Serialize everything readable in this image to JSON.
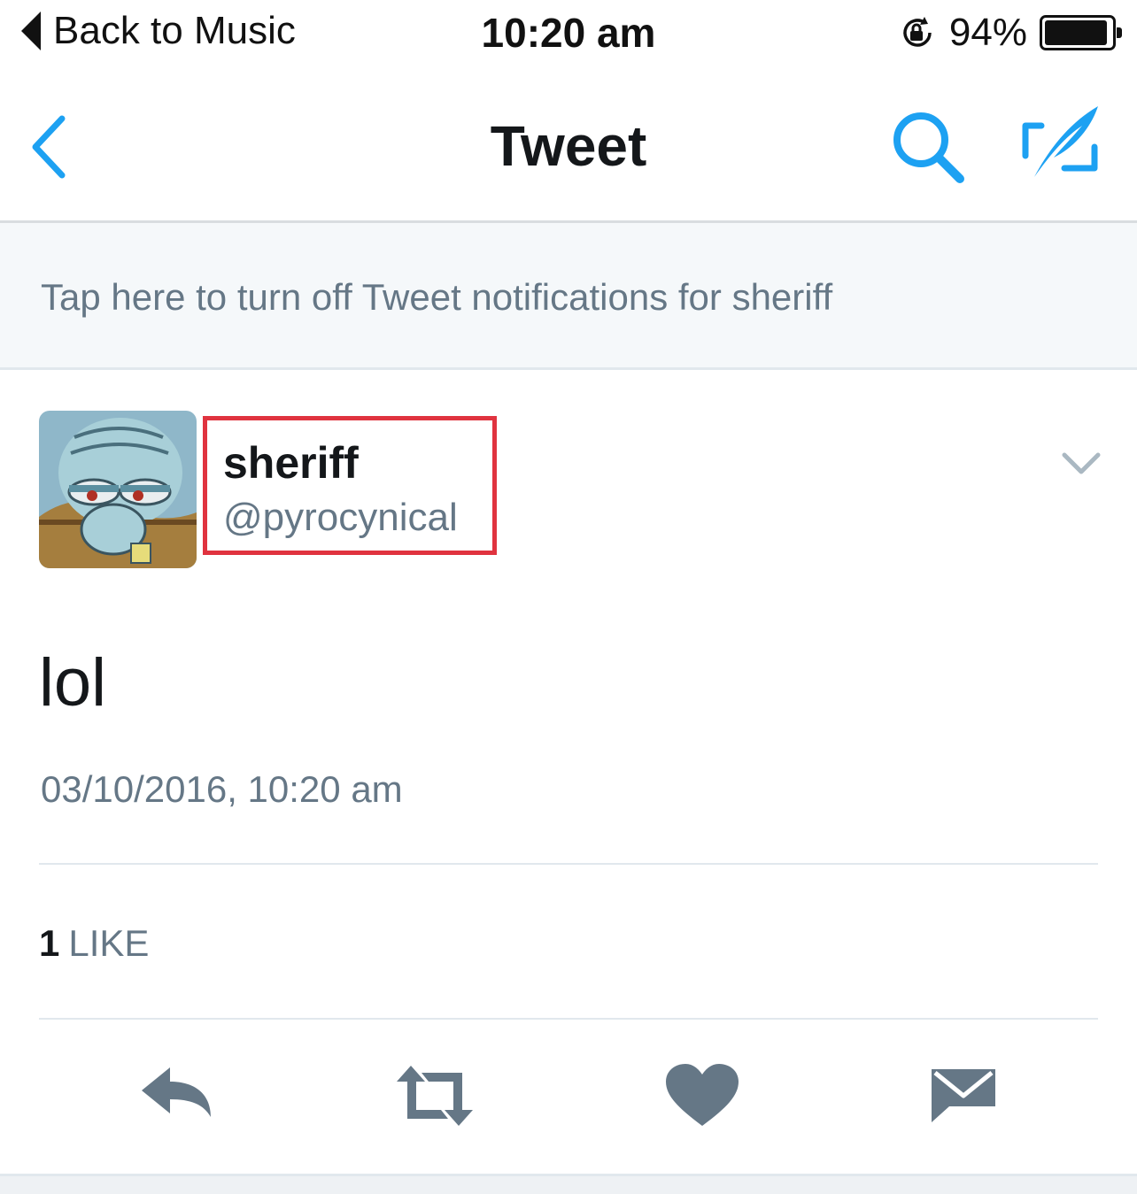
{
  "status_bar": {
    "back_app_label": "Back to Music",
    "time": "10:20 am",
    "battery_percent": "94%",
    "battery_level": 0.94
  },
  "nav": {
    "title": "Tweet",
    "icons": [
      "back-chevron-icon",
      "search-icon",
      "compose-tweet-icon"
    ],
    "accent_color": "#1da1f2"
  },
  "notification": {
    "text": "Tap here to turn off Tweet notifications for sheriff"
  },
  "tweet": {
    "author_name": "sheriff",
    "author_handle": "@pyrocynical",
    "text": "lol",
    "timestamp": "03/10/2016, 10:20 am",
    "like_count": "1",
    "like_label": "LIKE",
    "highlight_color": "#e0333f"
  },
  "actions": [
    "reply-icon",
    "retweet-icon",
    "like-heart-icon",
    "direct-message-icon"
  ]
}
